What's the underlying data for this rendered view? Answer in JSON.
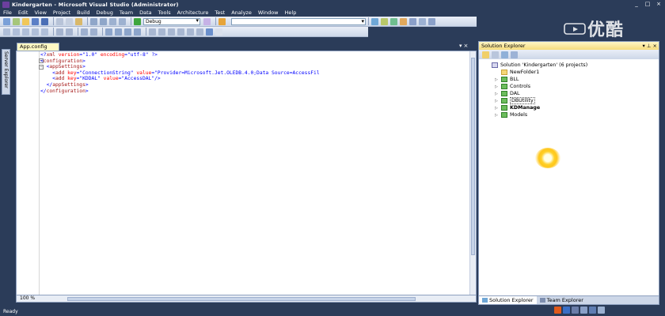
{
  "window": {
    "title": "Kindergarten - Microsoft Visual Studio (Administrator)",
    "controls": [
      "_",
      "□",
      "×"
    ]
  },
  "menu": [
    "File",
    "Edit",
    "View",
    "Project",
    "Build",
    "Debug",
    "Team",
    "Data",
    "Tools",
    "Architecture",
    "Test",
    "Analyze",
    "Window",
    "Help"
  ],
  "toolbar": {
    "configuration": "Debug"
  },
  "watermark": "优酷",
  "left_tabs": {
    "server_explorer": "Server Explorer"
  },
  "editor": {
    "tab": "App.config",
    "tab_controls": [
      "▾",
      "×"
    ],
    "zoom": "100 %",
    "lines": [
      {
        "indent": 0,
        "parts": [
          [
            "blue",
            "<?"
          ],
          [
            "brown",
            "xml"
          ],
          [
            "red",
            " version"
          ],
          [
            "blue",
            "=\""
          ],
          [
            "blue",
            "1.0"
          ],
          [
            "blue",
            "\""
          ],
          [
            "red",
            " encoding"
          ],
          [
            "blue",
            "=\""
          ],
          [
            "blue",
            "utf-8"
          ],
          [
            "blue",
            "\""
          ],
          [
            "blue",
            " ?>"
          ]
        ]
      },
      {
        "indent": 0,
        "parts": [
          [
            "blue",
            "<"
          ],
          [
            "brown",
            "configuration"
          ],
          [
            "blue",
            ">"
          ]
        ]
      },
      {
        "indent": 1,
        "parts": [
          [
            "blue",
            "<"
          ],
          [
            "brown",
            "appSettings"
          ],
          [
            "blue",
            ">"
          ]
        ]
      },
      {
        "indent": 2,
        "parts": [
          [
            "blue",
            "<"
          ],
          [
            "brown",
            "add"
          ],
          [
            "red",
            " key"
          ],
          [
            "blue",
            "=\""
          ],
          [
            "blue",
            "ConnectionString"
          ],
          [
            "blue",
            "\""
          ],
          [
            "red",
            " value"
          ],
          [
            "blue",
            "=\""
          ],
          [
            "blue",
            "Provider=Microsoft.Jet.OLEDB.4.0;Data Source=AccessFil"
          ]
        ]
      },
      {
        "indent": 2,
        "parts": [
          [
            "blue",
            "<"
          ],
          [
            "brown",
            "add"
          ],
          [
            "red",
            " key"
          ],
          [
            "blue",
            "=\""
          ],
          [
            "blue",
            "KDDAL"
          ],
          [
            "blue",
            "\""
          ],
          [
            "red",
            " value"
          ],
          [
            "blue",
            "=\""
          ],
          [
            "blue",
            "AccessDAL"
          ],
          [
            "blue",
            "\""
          ],
          [
            "blue",
            "/>"
          ]
        ]
      },
      {
        "indent": 1,
        "parts": [
          [
            "blue",
            "</"
          ],
          [
            "brown",
            "appSettings"
          ],
          [
            "blue",
            ">"
          ]
        ]
      },
      {
        "indent": 0,
        "parts": [
          [
            "blue",
            "</"
          ],
          [
            "brown",
            "configuration"
          ],
          [
            "blue",
            ">"
          ]
        ]
      }
    ]
  },
  "solution_explorer": {
    "title": "Solution Explorer",
    "header_controls": "▾ ⊥ ×",
    "nodes": [
      {
        "label": "Solution 'Kindergarten' (6 projects)",
        "level": 0,
        "icon": "solution",
        "expander": ""
      },
      {
        "label": "NewFolder1",
        "level": 1,
        "icon": "folder",
        "expander": ""
      },
      {
        "label": "BLL",
        "level": 1,
        "icon": "project",
        "expander": "▷"
      },
      {
        "label": "Controls",
        "level": 1,
        "icon": "project",
        "expander": "▷"
      },
      {
        "label": "DAL",
        "level": 1,
        "icon": "project",
        "expander": "▷"
      },
      {
        "label": "DBUtility",
        "level": 1,
        "icon": "project",
        "expander": "▷",
        "selected": true
      },
      {
        "label": "KDManage",
        "level": 1,
        "icon": "project",
        "expander": "▷",
        "bold": true
      },
      {
        "label": "Models",
        "level": 1,
        "icon": "project",
        "expander": "▷"
      }
    ],
    "bottom_tabs": [
      "Solution Explorer",
      "Team Explorer"
    ]
  },
  "status": {
    "text": "Ready"
  },
  "colors": {
    "chrome": "#2b3c59",
    "panel_header": "#f6dc7c",
    "tab_active": "#fff8c4"
  }
}
